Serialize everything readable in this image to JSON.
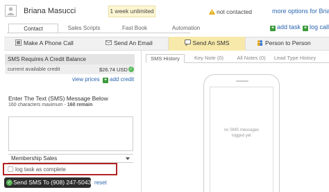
{
  "header": {
    "lead_name": "Briana Masucci",
    "plan_badge": "1 week unlimited",
    "status": "not contacted",
    "more_options": "more options for Brian"
  },
  "tabs": [
    {
      "label": "Contact",
      "active": true
    },
    {
      "label": "Sales Scripts",
      "active": false
    },
    {
      "label": "Fast Book",
      "active": false
    },
    {
      "label": "Automation",
      "active": false
    }
  ],
  "links": {
    "add_task": "add task",
    "log_call": "log call"
  },
  "actions": [
    {
      "label": "Make A Phone Call",
      "icon": "phone-icon"
    },
    {
      "label": "Send An Email",
      "icon": "email-icon"
    },
    {
      "label": "Send An SMS",
      "icon": "sms-icon",
      "active": true
    },
    {
      "label": "Person to Person",
      "icon": "people-icon"
    }
  ],
  "credit": {
    "heading": "SMS Requires A Credit Balance",
    "label": "current available credit",
    "amount": "$26.74 USD",
    "view_prices": "view prices",
    "add_credit": "add credit"
  },
  "sms_form": {
    "label": "Enter The Text (SMS) Message Below",
    "sub": "160 characters maximum - ",
    "remain": "160 remain",
    "message_value": "",
    "template_selected": "Membership Sales",
    "log_task_label": "log task as complete",
    "log_task_checked": false,
    "send_button": "Send SMS To (908) 247-5043",
    "reset": "reset"
  },
  "right_tabs": [
    {
      "label": "SMS History",
      "active": true
    },
    {
      "label": "Key Note (0)",
      "active": false
    },
    {
      "label": "All Notes (0)",
      "active": false
    },
    {
      "label": "Lead Type History",
      "active": false
    }
  ],
  "phone_preview": {
    "empty_message": "no SMS messages logged yet"
  },
  "colors": {
    "link": "#2c66b0",
    "active_tab": "#f7e9a9",
    "badge_bg": "#fdf6d2",
    "highlight_box": "#b22222",
    "send_button": "#2d2d2d",
    "success": "#5cb85c"
  }
}
